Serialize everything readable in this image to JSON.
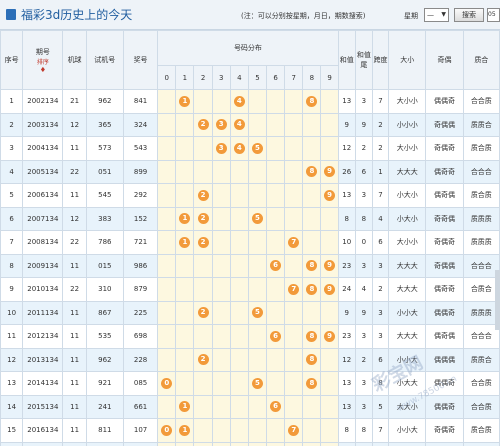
{
  "header": {
    "title": "福彩3d历史上的今天",
    "hint": "(注：可以分别按星期，月日，期数搜索)",
    "week_label": "星期",
    "week_value": "—",
    "search_label": "搜索",
    "extra_value": "05"
  },
  "columns": {
    "seq": "序号",
    "issue": "期号",
    "sort_tag": "排序",
    "machine": "机球",
    "trial": "试机号",
    "prize": "奖号",
    "dist": "号码分布",
    "digits": [
      "0",
      "1",
      "2",
      "3",
      "4",
      "5",
      "6",
      "7",
      "8",
      "9"
    ],
    "sum": "和值",
    "tail": "和值尾",
    "span": "跨度",
    "size": "大小",
    "parity": "奇偶",
    "prime": "质合"
  },
  "rows": [
    {
      "seq": "1",
      "issue": "2002134",
      "machine": "21",
      "trial": "962",
      "prize": "841",
      "balls": [
        1,
        4,
        8
      ],
      "sum": "13",
      "tail": "3",
      "span": "7",
      "size": "大小小",
      "parity": "偶偶奇",
      "prime": "合合质"
    },
    {
      "seq": "2",
      "issue": "2003134",
      "machine": "12",
      "trial": "365",
      "prize": "324",
      "balls": [
        2,
        3,
        4
      ],
      "sum": "9",
      "tail": "9",
      "span": "2",
      "size": "小小小",
      "parity": "奇偶偶",
      "prime": "质质合"
    },
    {
      "seq": "3",
      "issue": "2004134",
      "machine": "11",
      "trial": "573",
      "prize": "543",
      "balls": [
        3,
        4,
        5
      ],
      "sum": "12",
      "tail": "2",
      "span": "2",
      "size": "大小小",
      "parity": "奇偶奇",
      "prime": "质合质"
    },
    {
      "seq": "4",
      "issue": "2005134",
      "machine": "22",
      "trial": "051",
      "prize": "899",
      "balls": [
        8,
        9
      ],
      "doubles": [
        9
      ],
      "sum": "26",
      "tail": "6",
      "span": "1",
      "size": "大大大",
      "parity": "偶奇奇",
      "prime": "合合合"
    },
    {
      "seq": "5",
      "issue": "2006134",
      "machine": "11",
      "trial": "545",
      "prize": "292",
      "balls": [
        2,
        9
      ],
      "doubles": [
        2
      ],
      "sum": "13",
      "tail": "3",
      "span": "7",
      "size": "小大小",
      "parity": "偶奇偶",
      "prime": "质合质"
    },
    {
      "seq": "6",
      "issue": "2007134",
      "machine": "12",
      "trial": "383",
      "prize": "152",
      "balls": [
        1,
        2,
        5
      ],
      "sum": "8",
      "tail": "8",
      "span": "4",
      "size": "小大小",
      "parity": "奇奇偶",
      "prime": "质质质"
    },
    {
      "seq": "7",
      "issue": "2008134",
      "machine": "22",
      "trial": "786",
      "prize": "721",
      "balls": [
        1,
        2,
        7
      ],
      "sum": "10",
      "tail": "0",
      "span": "6",
      "size": "大小小",
      "parity": "奇偶奇",
      "prime": "质质质"
    },
    {
      "seq": "8",
      "issue": "2009134",
      "machine": "11",
      "trial": "015",
      "prize": "986",
      "balls": [
        6,
        8,
        9
      ],
      "sum": "23",
      "tail": "3",
      "span": "3",
      "size": "大大大",
      "parity": "奇偶偶",
      "prime": "合合合"
    },
    {
      "seq": "9",
      "issue": "2010134",
      "machine": "22",
      "trial": "310",
      "prize": "879",
      "balls": [
        7,
        8,
        9
      ],
      "sum": "24",
      "tail": "4",
      "span": "2",
      "size": "大大大",
      "parity": "偶奇奇",
      "prime": "合质合"
    },
    {
      "seq": "10",
      "issue": "2011134",
      "machine": "11",
      "trial": "867",
      "prize": "225",
      "balls": [
        2,
        5
      ],
      "doubles": [
        2
      ],
      "sum": "9",
      "tail": "9",
      "span": "3",
      "size": "小小大",
      "parity": "偶偶奇",
      "prime": "质质质"
    },
    {
      "seq": "11",
      "issue": "2012134",
      "machine": "11",
      "trial": "535",
      "prize": "698",
      "balls": [
        6,
        8,
        9
      ],
      "sum": "23",
      "tail": "3",
      "span": "3",
      "size": "大大大",
      "parity": "偶奇偶",
      "prime": "合合合"
    },
    {
      "seq": "12",
      "issue": "2013134",
      "machine": "11",
      "trial": "962",
      "prize": "228",
      "balls": [
        2,
        8
      ],
      "doubles": [
        2
      ],
      "sum": "12",
      "tail": "2",
      "span": "6",
      "size": "小小大",
      "parity": "偶偶偶",
      "prime": "质质合"
    },
    {
      "seq": "13",
      "issue": "2014134",
      "machine": "11",
      "trial": "921",
      "prize": "085",
      "balls": [
        0,
        5,
        8
      ],
      "sum": "13",
      "tail": "3",
      "span": "8",
      "size": "小大大",
      "parity": "偶偶奇",
      "prime": "合合质"
    },
    {
      "seq": "14",
      "issue": "2015134",
      "machine": "11",
      "trial": "241",
      "prize": "661",
      "balls": [
        1,
        6
      ],
      "doubles": [
        6
      ],
      "sum": "13",
      "tail": "3",
      "span": "5",
      "size": "大大小",
      "parity": "偶偶奇",
      "prime": "合合质"
    },
    {
      "seq": "15",
      "issue": "2016134",
      "machine": "11",
      "trial": "811",
      "prize": "107",
      "balls": [
        0,
        1,
        7
      ],
      "sum": "8",
      "tail": "8",
      "span": "7",
      "size": "小小大",
      "parity": "奇偶奇",
      "prime": "质合质"
    },
    {
      "seq": "16",
      "issue": "2017134",
      "machine": "11",
      "trial": "292",
      "prize": "359",
      "balls": [
        3,
        5,
        9
      ],
      "sum": "17",
      "tail": "7",
      "span": "6",
      "size": "小大大",
      "parity": "奇奇奇",
      "prime": "质质合"
    }
  ],
  "watermark": {
    "main": "彩宝网",
    "sub": "www.78500.cn"
  },
  "colors": {
    "ball": "#f29a3a",
    "title": "#215ea0",
    "header_bg": "#eef3f8",
    "dist_bg": "#fdf8e0",
    "row_alt": "#e8f3fb"
  }
}
